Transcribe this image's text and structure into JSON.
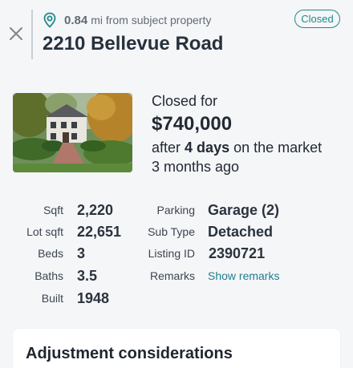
{
  "header": {
    "distance_value": "0.84",
    "distance_text": "mi from subject property",
    "address": "2210 Bellevue Road",
    "status": "Closed"
  },
  "summary": {
    "closed_for": "Closed for",
    "price": "$740,000",
    "after": "after",
    "days": "4 days",
    "market_text": "on the market",
    "ago": "3 months ago"
  },
  "facts_left": [
    {
      "label": "Sqft",
      "value": "2,220"
    },
    {
      "label": "Lot sqft",
      "value": "22,651"
    },
    {
      "label": "Beds",
      "value": "3"
    },
    {
      "label": "Baths",
      "value": "3.5"
    },
    {
      "label": "Built",
      "value": "1948"
    }
  ],
  "facts_right": [
    {
      "label": "Parking",
      "value": "Garage (2)"
    },
    {
      "label": "Sub Type",
      "value": "Detached"
    },
    {
      "label": "Listing ID",
      "value": "2390721"
    },
    {
      "label": "Remarks",
      "value": "Show remarks"
    }
  ],
  "adjustments": {
    "title": "Adjustment considerations"
  },
  "colors": {
    "accent": "#1f8a8a",
    "link": "#1f7d8f",
    "background": "#f5f6f8"
  },
  "icons": {
    "close": "close-icon",
    "pin": "map-pin-icon"
  }
}
